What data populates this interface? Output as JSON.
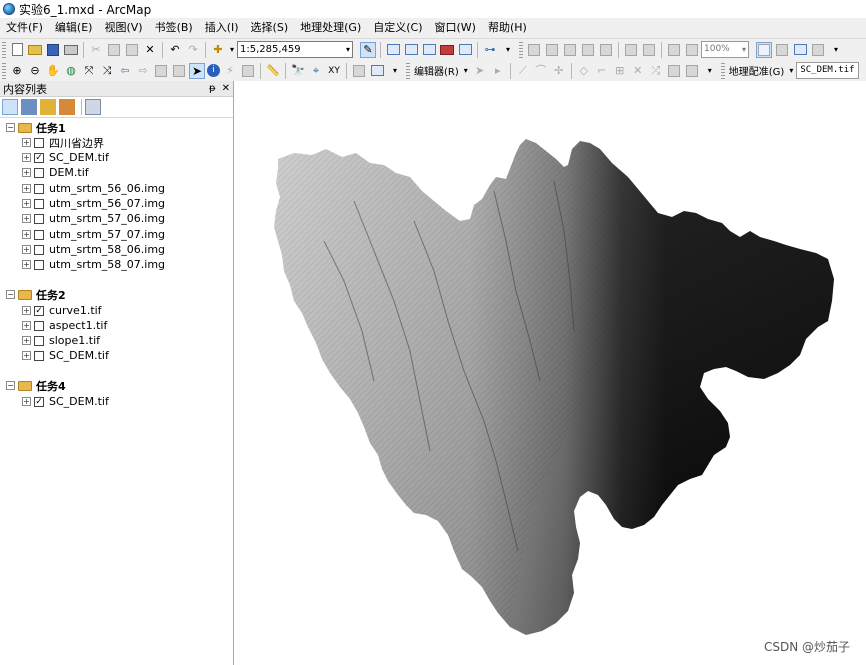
{
  "window": {
    "title": "实验6_1.mxd - ArcMap"
  },
  "menu": [
    "文件(F)",
    "编辑(E)",
    "视图(V)",
    "书签(B)",
    "插入(I)",
    "选择(S)",
    "地理处理(G)",
    "自定义(C)",
    "窗口(W)",
    "帮助(H)"
  ],
  "toolbar": {
    "scale": "1:5,285,459",
    "zoom": "100%",
    "editor_label": "编辑器(R)",
    "georef_label": "地理配准(G)",
    "georef_layer": "SC_DEM.tif"
  },
  "toc": {
    "title": "内容列表",
    "pin": "ᵽ",
    "close": "✕",
    "groups": [
      {
        "name": "任务1",
        "layers": [
          {
            "name": "四川省边界",
            "checked": false
          },
          {
            "name": "SC_DEM.tif",
            "checked": true
          },
          {
            "name": "DEM.tif",
            "checked": false
          },
          {
            "name": "utm_srtm_56_06.img",
            "checked": false
          },
          {
            "name": "utm_srtm_56_07.img",
            "checked": false
          },
          {
            "name": "utm_srtm_57_06.img",
            "checked": false
          },
          {
            "name": "utm_srtm_57_07.img",
            "checked": false
          },
          {
            "name": "utm_srtm_58_06.img",
            "checked": false
          },
          {
            "name": "utm_srtm_58_07.img",
            "checked": false
          }
        ]
      },
      {
        "name": "任务2",
        "layers": [
          {
            "name": "curve1.tif",
            "checked": true
          },
          {
            "name": "aspect1.tif",
            "checked": false
          },
          {
            "name": "slope1.tif",
            "checked": false
          },
          {
            "name": "SC_DEM.tif",
            "checked": false
          }
        ]
      },
      {
        "name": "任务4",
        "layers": [
          {
            "name": "SC_DEM.tif",
            "checked": true
          }
        ]
      }
    ]
  },
  "watermark": "CSDN @炒茄子"
}
